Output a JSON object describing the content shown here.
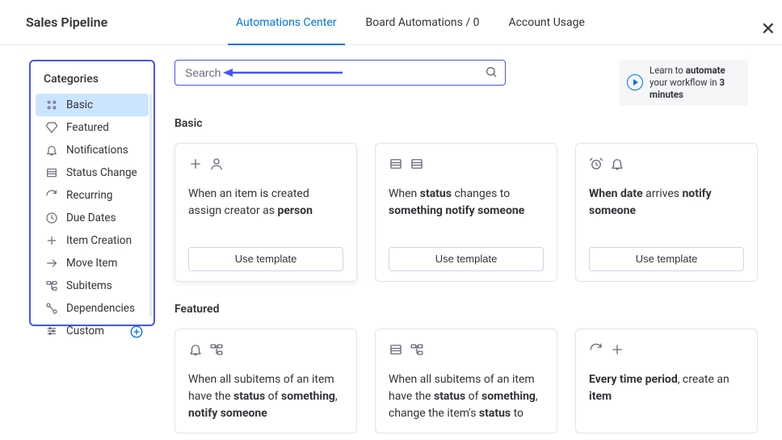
{
  "header": {
    "title": "Sales Pipeline",
    "tabs": [
      {
        "label": "Automations Center",
        "active": true
      },
      {
        "label": "Board Automations / 0",
        "active": false
      },
      {
        "label": "Account Usage",
        "active": false
      }
    ]
  },
  "sidebar": {
    "title": "Categories",
    "items": [
      {
        "label": "Basic",
        "icon": "basic",
        "active": true
      },
      {
        "label": "Featured",
        "icon": "diamond",
        "active": false
      },
      {
        "label": "Notifications",
        "icon": "bell",
        "active": false
      },
      {
        "label": "Status Change",
        "icon": "list",
        "active": false
      },
      {
        "label": "Recurring",
        "icon": "recurring",
        "active": false
      },
      {
        "label": "Due Dates",
        "icon": "clock",
        "active": false
      },
      {
        "label": "Item Creation",
        "icon": "plus",
        "active": false
      },
      {
        "label": "Move Item",
        "icon": "arrow-right",
        "active": false
      },
      {
        "label": "Subitems",
        "icon": "subitems",
        "active": false
      },
      {
        "label": "Dependencies",
        "icon": "dependencies",
        "active": false
      },
      {
        "label": "Custom",
        "icon": "custom",
        "active": false,
        "hasAdd": true
      }
    ]
  },
  "search": {
    "placeholder": "Search"
  },
  "learn": {
    "pre": "Learn to ",
    "bold1": "automate",
    "mid": " your workflow in ",
    "bold2": "3 minutes"
  },
  "sections": [
    {
      "label": "Basic",
      "cards": [
        {
          "icons": [
            "plus",
            "person"
          ],
          "parts": [
            "When an item is created assign creator as ",
            "<b>person</b>"
          ],
          "raised": true,
          "btn": "Use template"
        },
        {
          "icons": [
            "list",
            "list"
          ],
          "parts": [
            "When ",
            "<b>status</b>",
            " changes to ",
            "<b>something</b>",
            " ",
            "<b>notify</b>",
            " ",
            "<b>someone</b>"
          ],
          "btn": "Use template"
        },
        {
          "icons": [
            "alarm",
            "bell"
          ],
          "parts": [
            "<b>When</b>",
            " ",
            "<b>date</b>",
            " arrives ",
            "<b>notify someone</b>"
          ],
          "btn": "Use template"
        }
      ]
    },
    {
      "label": "Featured",
      "cards": [
        {
          "icons": [
            "bell",
            "subitems"
          ],
          "parts": [
            "When all subitems of an item have the ",
            "<b>status</b>",
            " of ",
            "<b>something</b>",
            ", ",
            "<b>notify someone</b>"
          ]
        },
        {
          "icons": [
            "list",
            "subitems"
          ],
          "parts": [
            "When all subitems of an item have the ",
            "<b>status</b>",
            " of ",
            "<b>something</b>",
            ", change the item's ",
            "<b>status</b>",
            " to"
          ]
        },
        {
          "icons": [
            "recurring",
            "plus"
          ],
          "parts": [
            "<b>Every time period</b>",
            ", create an ",
            "<b>item</b>"
          ]
        }
      ]
    }
  ]
}
